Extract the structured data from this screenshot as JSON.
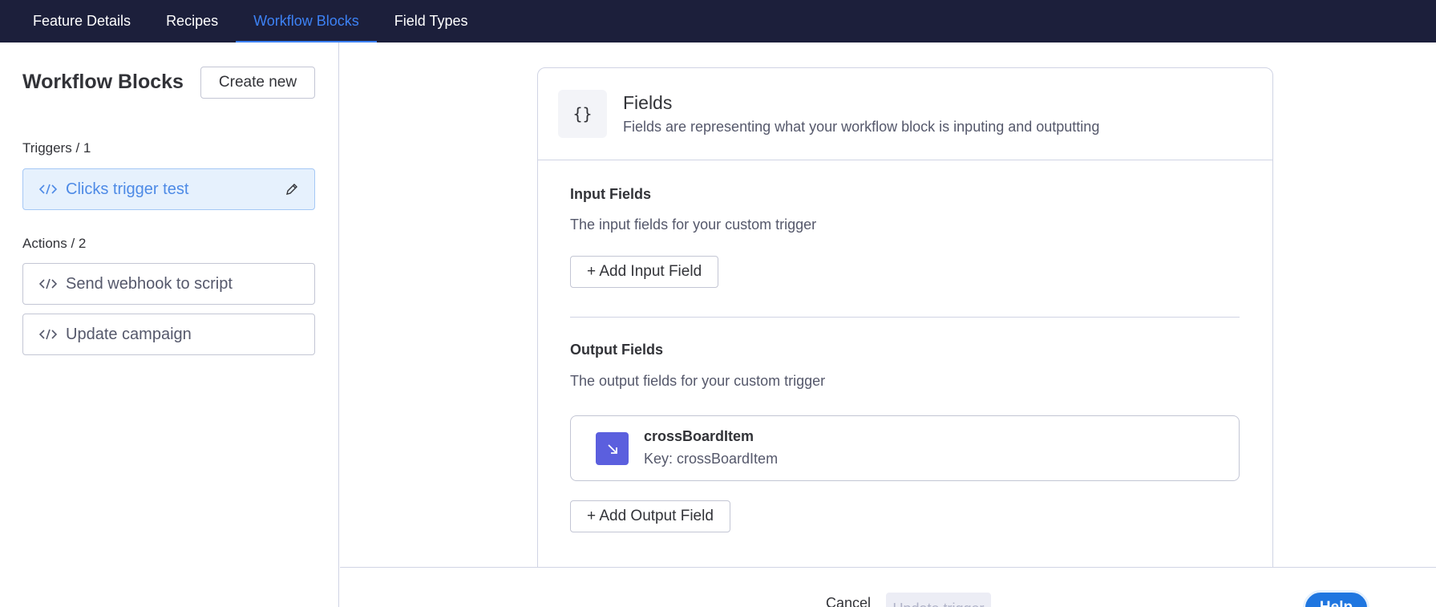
{
  "nav": {
    "tabs": [
      {
        "label": "Feature Details"
      },
      {
        "label": "Recipes"
      },
      {
        "label": "Workflow Blocks"
      },
      {
        "label": "Field Types"
      }
    ]
  },
  "sidebar": {
    "title": "Workflow Blocks",
    "create_label": "Create new",
    "triggers_label": "Triggers / 1",
    "triggers": [
      {
        "label": "Clicks trigger test"
      }
    ],
    "actions_label": "Actions / 2",
    "actions": [
      {
        "label": "Send webhook to script"
      },
      {
        "label": "Update campaign"
      }
    ]
  },
  "card": {
    "icon_glyph": "{}",
    "title": "Fields",
    "subtitle": "Fields are representing what your workflow block is inputing and outputting",
    "input": {
      "title": "Input Fields",
      "desc": "The input fields for your custom trigger",
      "add_label": "+ Add Input Field"
    },
    "output": {
      "title": "Output Fields",
      "desc": "The output fields for your custom trigger",
      "add_label": "+ Add Output Field",
      "fields": [
        {
          "name": "crossBoardItem",
          "key": "Key: crossBoardItem"
        }
      ]
    }
  },
  "footer": {
    "cancel_label": "Cancel",
    "update_label": "Update trigger",
    "help_label": "Help"
  },
  "colors": {
    "nav_bg": "#1c1f3b",
    "accent": "#3d82f5",
    "field_icon": "#5b5fde",
    "help": "#1f76e0"
  }
}
